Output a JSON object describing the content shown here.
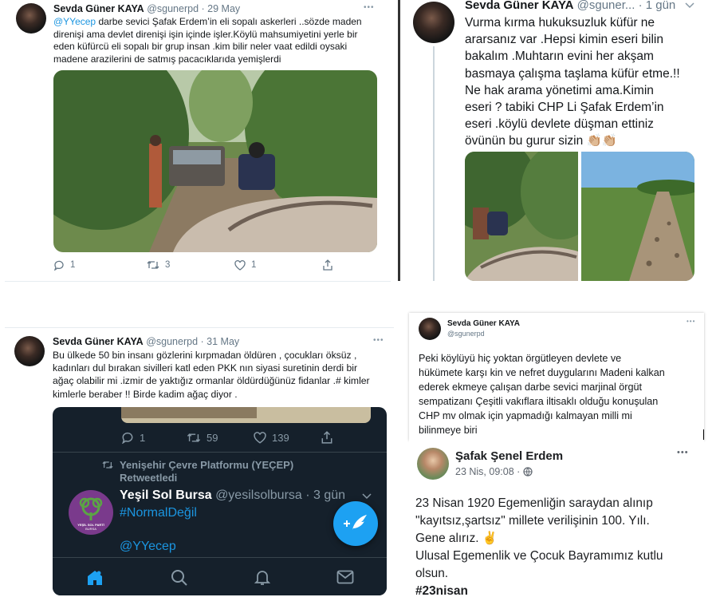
{
  "tweet1": {
    "name": "Sevda Güner KAYA",
    "handle": "@sgunerpd",
    "date": "· 29 May",
    "mention": "@YYecep",
    "line1": " darbe sevici Şafak Erdem’in eli sopalı askerleri ..sözde maden",
    "line2": "direnişi ama devlet direnişi işin içinde işler.Köylü mahsumiyetini yerle bir",
    "line3": "eden küfürcü eli sopalı bir grup insan .kim bilir neler vaat edildi oysaki",
    "line4": "madene arazilerini de satmış pacacıklarıda yemişlerdi",
    "replies": "1",
    "retweets": "3",
    "likes": "1",
    "more": "•••"
  },
  "tweet2": {
    "name": "Sevda Güner KAYA",
    "handle": "@sguner...",
    "date": "· 1 gün",
    "lines": [
      "Vurma kırma hukuksuzluk küfür ne",
      "ararsanız var .Hepsi kimin eseri bilin",
      "bakalım .Muhtarın evini her akşam",
      "basmaya çalışma taşlama küfür etme.!!",
      "Ne hak arama yönetimi ama.Kimin",
      "eseri ? tabiki CHP Li Şafak Erdem’in",
      "eseri .köylü devlete düşman ettiniz",
      "övünün bu gurur sizin 👏🏼👏🏼"
    ]
  },
  "tweet3": {
    "name": "Sevda Güner KAYA",
    "handle": "@sgunerpd",
    "date": "· 31 May",
    "more": "•••",
    "lines": [
      "Bu ülkede 50 bin insanı gözlerini kırpmadan öldüren , çocukları öksüz ,",
      "kadınları dul bırakan sivilleri katl eden PKK nın siyasi suretinin  derdi bir",
      "ağaç olabilir mi .izmir de yaktığız ormanlar öldürdüğünüz fidanlar .# kimler",
      "kimlerle beraber !! Birde kadim ağaç diyor ."
    ],
    "embed": {
      "replies": "1",
      "retweets": "59",
      "likes": "139",
      "retweeted_by": "Yenişehir Çevre Platformu (YEÇEP)",
      "retweeted_label": "Retweetledi",
      "account_name": "Yeşil Sol Bursa",
      "account_handle": "@yesilsolbursa · 3 gün",
      "hashtag": "#NormalDeğil",
      "mention": "@YYecep",
      "logo_text": "YEŞİL SOL PARTİ\nBURSA"
    }
  },
  "post4": {
    "name": "Sevda Güner KAYA",
    "handle": "@sgunerpd",
    "more": "•••",
    "lines": [
      "Peki köylüyü hiç yoktan örgütleyen devlete ve",
      "hükümete karşı kin ve nefret duygularını Madeni kalkan",
      "ederek ekmeye çalışan darbe sevici marjinal örgüt",
      "sempatizanı Çeşitli vakıflara iltisaklı olduğu konuşulan",
      "CHP mv olmak için yapmadığı kalmayan  milli mi",
      "bilinmeye biri"
    ]
  },
  "facebook": {
    "name": "Şafak Şenel Erdem",
    "date": "23 Nis, 09:08 ·",
    "more": "•••",
    "line1": "23 Nisan 1920 Egemenliğin saraydan alınıp",
    "line2": "\"kayıtsız,şartsız\" millete verilişinin 100. Yılı.",
    "line3": "Gene alırız. ✌️",
    "line4": "Ulusal Egemenlik ve Çocuk Bayramımız kutlu",
    "line5": "olsun.",
    "hashtag": "#23nisan"
  },
  "colors": {
    "twitter_blue": "#1b95e0",
    "dark_bg": "#15202b",
    "yesil_green": "#5ba544",
    "logo_purple": "#7a3a8c"
  }
}
